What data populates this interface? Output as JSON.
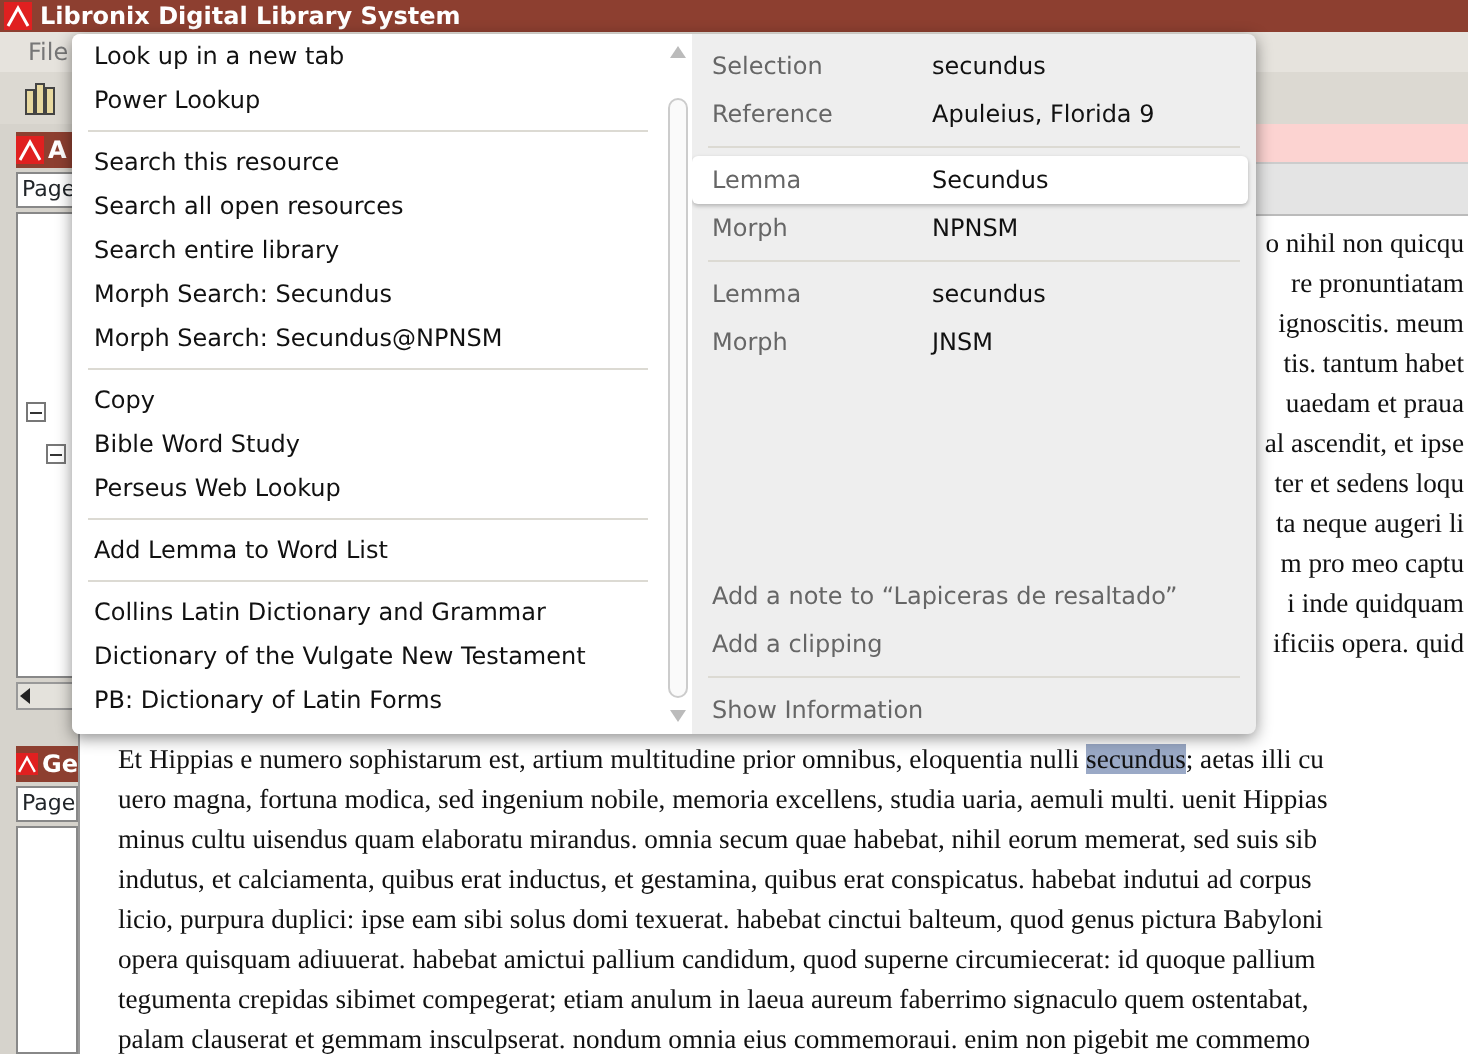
{
  "window": {
    "title": "Libronix Digital Library System"
  },
  "menu_bar": [
    "File"
  ],
  "panels": [
    {
      "header": "A",
      "page_field": "Page",
      "tree": [
        {
          "expanded": true,
          "children": [
            {
              "expanded": true
            }
          ]
        }
      ]
    },
    {
      "header": "Ge",
      "page_field": "Page"
    }
  ],
  "document": {
    "right_fragments": [
      "o nihil non quicqu",
      "re pronuntiatam",
      "ignoscitis. meum",
      "tis. tantum habet",
      "uaedam et praua",
      "al ascendit, et ipse",
      "ter et sedens loqu",
      "ta neque augeri li",
      "m pro meo captu",
      "i inde quidquam",
      "ificiis opera. quid"
    ],
    "lines": [
      [
        {
          "text": "Et Hippias e numero sophistarum est, artium multitudine prior omnibus, eloquentia nulli ",
          "selected": false
        },
        {
          "text": "secundus",
          "selected": true
        },
        {
          "text": "; aetas illi cu",
          "selected": false
        }
      ],
      [
        {
          "text": "uero magna, fortuna modica, sed ingenium nobile, memoria excellens, studia uaria, aemuli multi. uenit Hippias",
          "selected": false
        }
      ],
      [
        {
          "text": "minus cultu uisendus quam elaboratu mirandus. omnia secum quae habebat, nihil eorum memerat, sed suis sib",
          "selected": false
        }
      ],
      [
        {
          "text": "indutus, et calciamenta, quibus erat inductus, et gestamina, quibus erat conspicatus. habebat indutui ad corpus",
          "selected": false
        }
      ],
      [
        {
          "text": "licio, purpura duplici: ipse eam sibi solus domi texuerat. habebat cinctui balteum, quod genus pictura Babyloni",
          "selected": false
        }
      ],
      [
        {
          "text": "opera quisquam adiuuerat. habebat amictui pallium candidum, quod superne circumiecerat: id quoque pallium",
          "selected": false
        }
      ],
      [
        {
          "text": "tegumenta crepidas sibimet compegerat; etiam anulum in laeua aureum faberrimo signaculo quem ostentabat,",
          "selected": false
        }
      ],
      [
        {
          "text": "palam clauserat et gemmam insculpserat. nondum omnia eius commemoraui. enim non pigebit me commemo",
          "selected": false
        }
      ]
    ]
  },
  "context_menu": {
    "groups": [
      [
        "Look up in a new tab",
        "Power Lookup"
      ],
      [
        "Search this resource",
        "Search all open resources",
        "Search entire library",
        "Morph Search: Secundus",
        "Morph Search: Secundus@NPNSM"
      ],
      [
        "Copy",
        "Bible Word Study",
        "Perseus Web Lookup"
      ],
      [
        "Add Lemma to Word List"
      ],
      [
        "Collins Latin Dictionary and Grammar",
        "Dictionary of the Vulgate New Testament",
        "PB: Dictionary of Latin Forms"
      ]
    ],
    "info": {
      "sections": [
        [
          {
            "label": "Selection",
            "value": "secundus",
            "selected": false
          },
          {
            "label": "Reference",
            "value": "Apuleius, Florida 9",
            "selected": false
          }
        ],
        [
          {
            "label": "Lemma",
            "value": "Secundus",
            "selected": true
          },
          {
            "label": "Morph",
            "value": "NPNSM",
            "selected": false
          }
        ],
        [
          {
            "label": "Lemma",
            "value": "secundus",
            "selected": false
          },
          {
            "label": "Morph",
            "value": "JNSM",
            "selected": false
          }
        ]
      ],
      "actions": [
        "Add a note to “Lapiceras de resaltado”",
        "Add a clipping"
      ],
      "footer": "Show Information"
    }
  }
}
